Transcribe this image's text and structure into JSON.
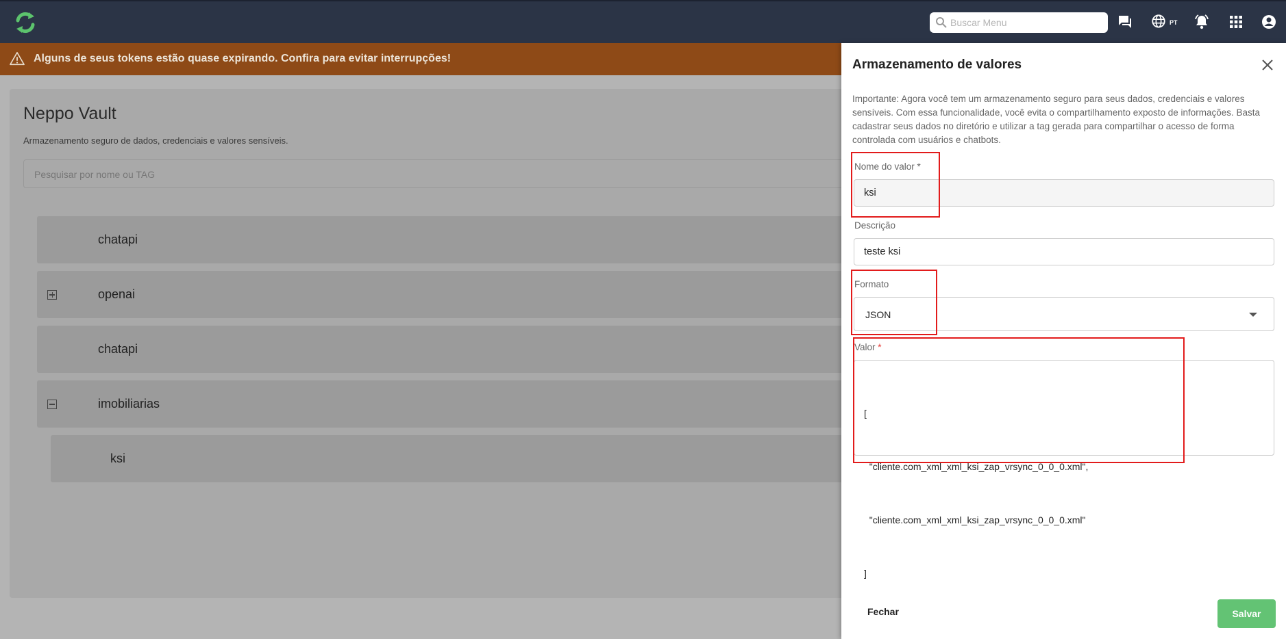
{
  "header": {
    "search_placeholder": "Buscar Menu",
    "language": "PT",
    "icons": [
      "chat-icon",
      "globe-icon",
      "bell-icon",
      "apps-grid-icon",
      "account-circle-icon"
    ]
  },
  "warning": {
    "text": "Alguns de seus tokens estão quase expirando. Confira para evitar interrupções!"
  },
  "vault": {
    "title": "Neppo Vault",
    "subtitle": "Armazenamento seguro de dados, credenciais e valores sensíveis.",
    "search_placeholder": "Pesquisar por nome ou TAG",
    "items": [
      {
        "label": "chatapi",
        "toggle": "none"
      },
      {
        "label": "openai",
        "toggle": "expand"
      },
      {
        "label": "chatapi",
        "toggle": "none"
      },
      {
        "label": "imobiliarias",
        "toggle": "collapse"
      },
      {
        "label": "ksi",
        "toggle": "none",
        "child": true
      }
    ]
  },
  "drawer": {
    "title": "Armazenamento de valores",
    "info": "Importante: Agora você tem um armazenamento seguro para seus dados, credenciais e valores sensíveis. Com essa funcionalidade, você evita o compartilhamento exposto de informações. Basta cadastrar seus dados no diretório e utilizar a tag gerada para compartilhar o acesso de forma controlada com usuários e chatbots.",
    "name_label": "Nome do valor *",
    "name_value": "ksi",
    "desc_label": "Descrição",
    "desc_value": "teste ksi",
    "format_label": "Formato",
    "format_value": "JSON",
    "value_label": "Valor",
    "value_required": "*",
    "value_lines": [
      "[",
      "  \"cliente.com_xml_xml_ksi_zap_vrsync_0_0_0.xml\",",
      "  \"cliente.com_xml_xml_ksi_zap_vrsync_0_0_0.xml\"",
      "]"
    ],
    "close_label": "Fechar",
    "save_label": "Salvar"
  },
  "colors": {
    "topbar": "#2b3446",
    "warning": "#8e4a17",
    "save": "#63c374",
    "highlight": "#e21b1b"
  }
}
